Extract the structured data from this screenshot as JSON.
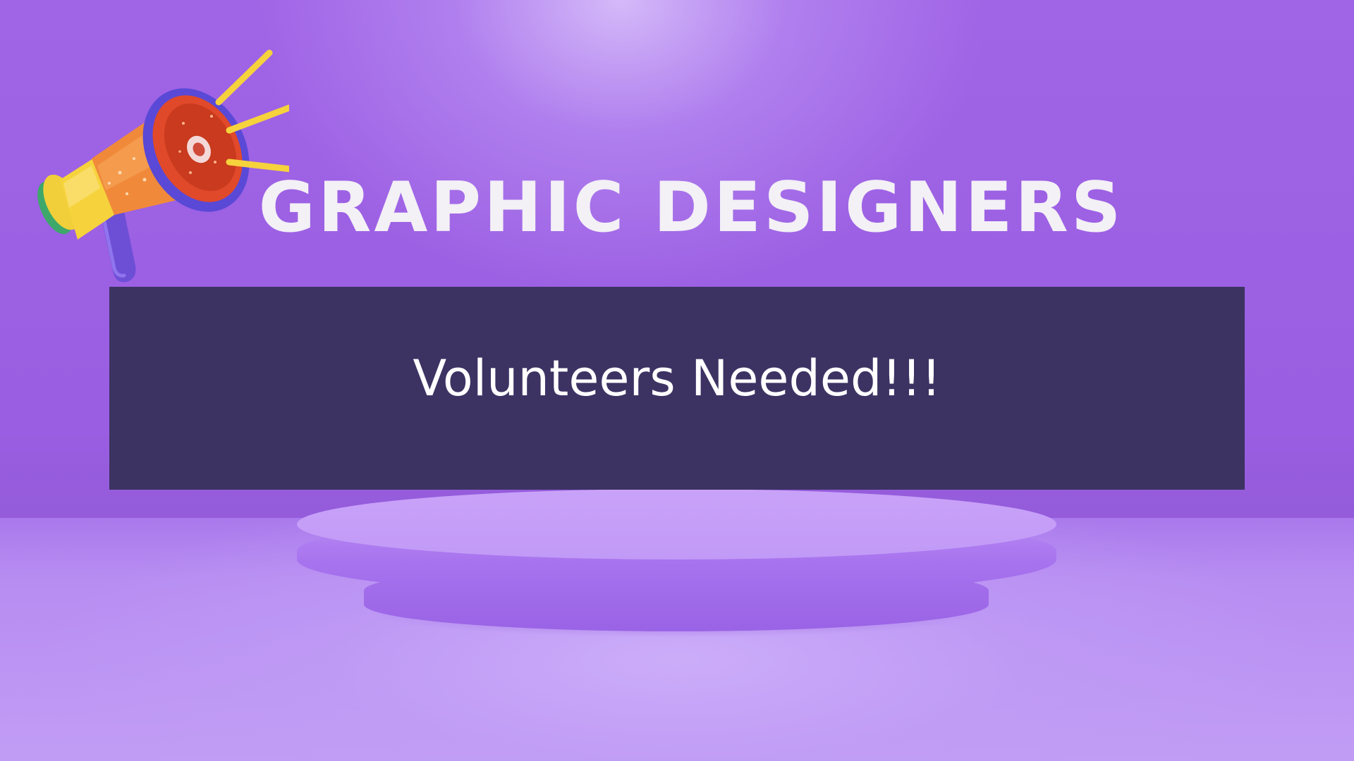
{
  "poster": {
    "title": "GRAPHIC DESIGNERS",
    "banner_text": "Volunteers Needed!!!"
  },
  "icons": {
    "megaphone": "megaphone-icon"
  },
  "colors": {
    "background_purple": "#9f63e4",
    "banner_navy": "#3c3363",
    "title_text": "#f3f0f6",
    "banner_text": "#ffffff",
    "pedestal_lilac": "#c19af7"
  }
}
